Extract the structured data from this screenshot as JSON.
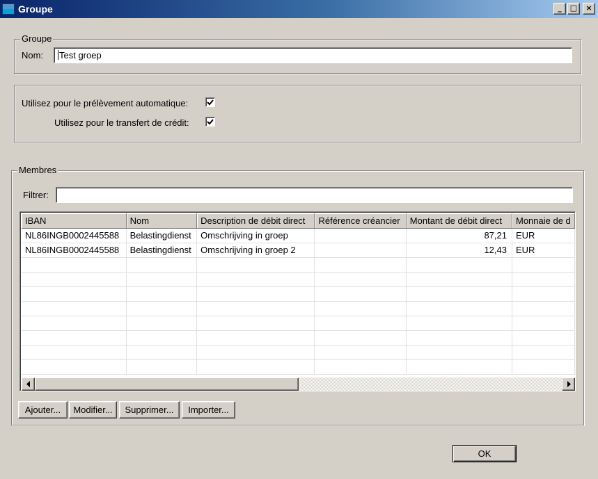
{
  "window": {
    "title": "Groupe",
    "app_icon": "window-app-icon",
    "minimize": "_",
    "maximize": "□",
    "close": "×"
  },
  "group": {
    "legend": "Groupe",
    "name_label": "Nom:",
    "name_value": "Test groep"
  },
  "options": {
    "direct_debit_label": "Utilisez pour le prélèvement automatique:",
    "direct_debit_checked": true,
    "credit_transfer_label": "Utilisez pour le transfert de crédit:",
    "credit_transfer_checked": true
  },
  "members": {
    "legend": "Membres",
    "filter_label": "Filtrer:",
    "filter_value": "",
    "columns": [
      "IBAN",
      "Nom",
      "Description de débit direct",
      "Référence créancier",
      "Montant de débit direct",
      "Monnaie de d"
    ],
    "rows": [
      [
        "NL86INGB0002445588",
        "Belastingdienst",
        "Omschrijving in groep",
        "",
        "87,21",
        "EUR"
      ],
      [
        "NL86INGB0002445588",
        "Belastingdienst",
        "Omschrijving in groep 2",
        "",
        "12,43",
        "EUR"
      ]
    ],
    "empty_rows": 8,
    "horizontal_scroll_fraction": 0.5,
    "buttons": {
      "add": "Ajouter...",
      "edit": "Modifier...",
      "delete": "Supprimer...",
      "import": "Importer..."
    }
  },
  "footer": {
    "ok": "OK"
  },
  "icons": {
    "left_arrow": "scroll-left-icon",
    "right_arrow": "scroll-right-icon",
    "check": "checkmark-icon"
  }
}
